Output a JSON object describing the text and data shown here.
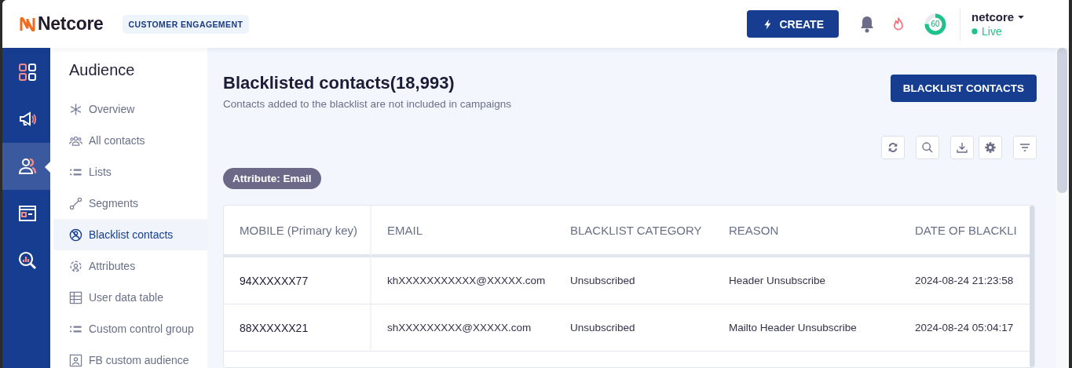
{
  "header": {
    "logo": "Netcore",
    "product_badge": "CUSTOMER ENGAGEMENT",
    "create_button": "CREATE",
    "score": {
      "text": "60",
      "level": 0.75
    },
    "account": {
      "name": "netcore",
      "status": "Live"
    }
  },
  "rail": [
    {
      "selected": false
    },
    {
      "selected": false
    },
    {
      "selected": true
    },
    {
      "selected": false
    },
    {
      "selected": false
    }
  ],
  "sidebar": {
    "title": "Audience",
    "items": [
      {
        "label": "Overview",
        "selected": false
      },
      {
        "label": "All contacts",
        "selected": false
      },
      {
        "label": "Lists",
        "selected": false
      },
      {
        "label": "Segments",
        "selected": false
      },
      {
        "label": "Blacklist contacts",
        "selected": true
      },
      {
        "label": "Attributes",
        "selected": false
      },
      {
        "label": "User data table",
        "selected": false
      },
      {
        "label": "Custom control group",
        "selected": false
      },
      {
        "label": "FB custom audience",
        "selected": false
      }
    ]
  },
  "page": {
    "title": "Blacklisted contacts(18,993)",
    "subtitle": "Contacts added to the blacklist are not included in campaigns",
    "action_button": "BLACKLIST CONTACTS",
    "filter_chip": "Attribute: Email"
  },
  "table": {
    "columns": [
      "MOBILE (Primary key)",
      "EMAIL",
      "BLACKLIST CATEGORY",
      "REASON",
      "DATE OF BLACKLI"
    ],
    "rows": [
      [
        "94XXXXXX77",
        "khXXXXXXXXXXX@XXXXX.com",
        "Unsubscribed",
        "Header Unsubscribe",
        "2024-08-24 21:23:58"
      ],
      [
        "88XXXXXX21",
        "shXXXXXXXXX@XXXXX.com",
        "Unsubscribed",
        "Mailto Header Unsubscribe",
        "2024-08-24 05:04:17"
      ]
    ]
  }
}
